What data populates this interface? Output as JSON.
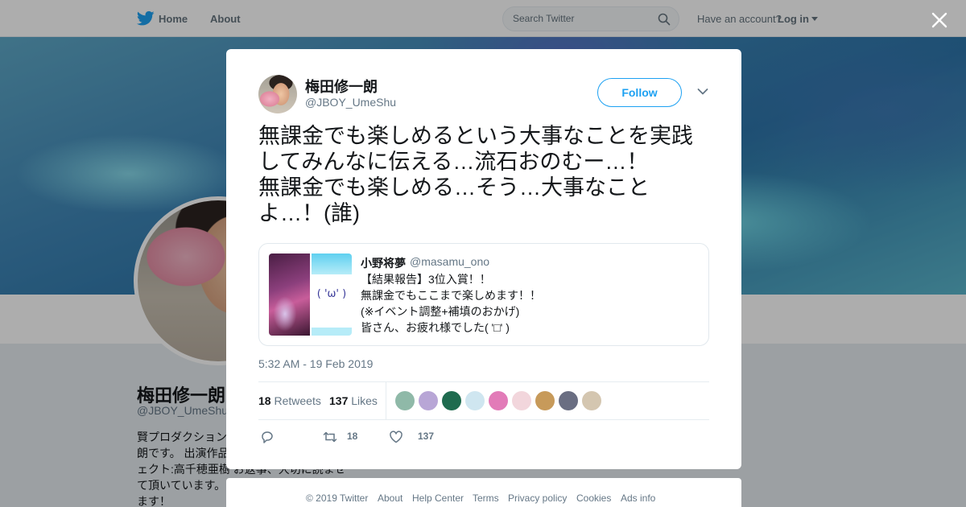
{
  "header": {
    "home_label": "Home",
    "about_label": "About",
    "search_placeholder": "Search Twitter",
    "have_account": "Have an account?",
    "login_label": "Log in",
    "brand_color": "#1da1f2"
  },
  "profile": {
    "name": "梅田修一朗",
    "handle": "@JBOY_UmeShu",
    "bio_lines": [
      "賢プロダクション",
      "朗です。 出演作品",
      "ェクト:高千穂亜樹 お返事、大切に読ませ",
      "て頂いています。",
      "ます！"
    ]
  },
  "tweet": {
    "author_name": "梅田修一朗",
    "author_handle": "@JBOY_UmeShu",
    "follow_label": "Follow",
    "text": "無課金でも楽しめるという大事なことを実践\nしてみんなに伝える…流石おのむー…！\n無課金でも楽しめる…そう…大事なこと\nよ…！(誰)",
    "timestamp": "5:32 AM - 19 Feb 2019",
    "retweets_count": "18",
    "retweets_label": "Retweets",
    "likes_count": "137",
    "likes_label": "Likes",
    "liker_colors": [
      "#8fb9a8",
      "#b8a6d6",
      "#1f6b4f",
      "#cfe6f0",
      "#e27bb8",
      "#f2d6dc",
      "#c79a5a",
      "#6a6e82",
      "#d4c6b0"
    ],
    "action_retweet_count": "18",
    "action_like_count": "137"
  },
  "quoted_tweet": {
    "name": "小野将夢",
    "handle": "@masamu_ono",
    "lines": [
      "【結果報告】3位入賞！！",
      "無課金でもここまで楽しめます！！",
      "(※イベント調整+補填のおかげ)",
      "皆さん、お疲れ様でした( '□' )"
    ],
    "media_kaomoji": "( 'ω' )"
  },
  "footer": {
    "copyright": "© 2019 Twitter",
    "links": [
      "About",
      "Help Center",
      "Terms",
      "Privacy policy",
      "Cookies",
      "Ads info"
    ]
  }
}
